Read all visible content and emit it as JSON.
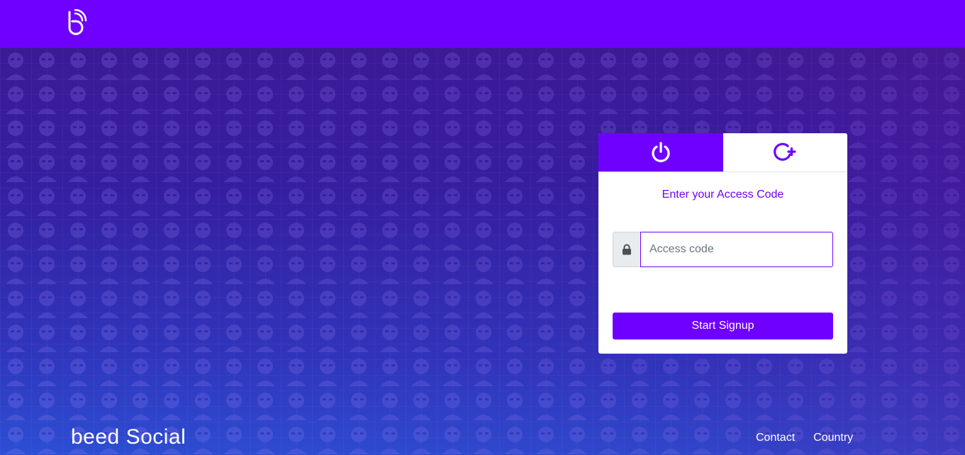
{
  "header": {
    "logo_icon": "beed-logo-icon",
    "brand_color": "#6f00ff"
  },
  "card": {
    "tabs": [
      {
        "icon": "power-icon",
        "active": true
      },
      {
        "icon": "add-circle-icon",
        "active": false
      }
    ],
    "title": "Enter your Access Code",
    "input": {
      "icon": "lock-icon",
      "placeholder": "Access code",
      "value": ""
    },
    "submit_label": "Start Signup"
  },
  "footer": {
    "brand": "beed Social",
    "links": [
      "Contact",
      "Country"
    ]
  }
}
